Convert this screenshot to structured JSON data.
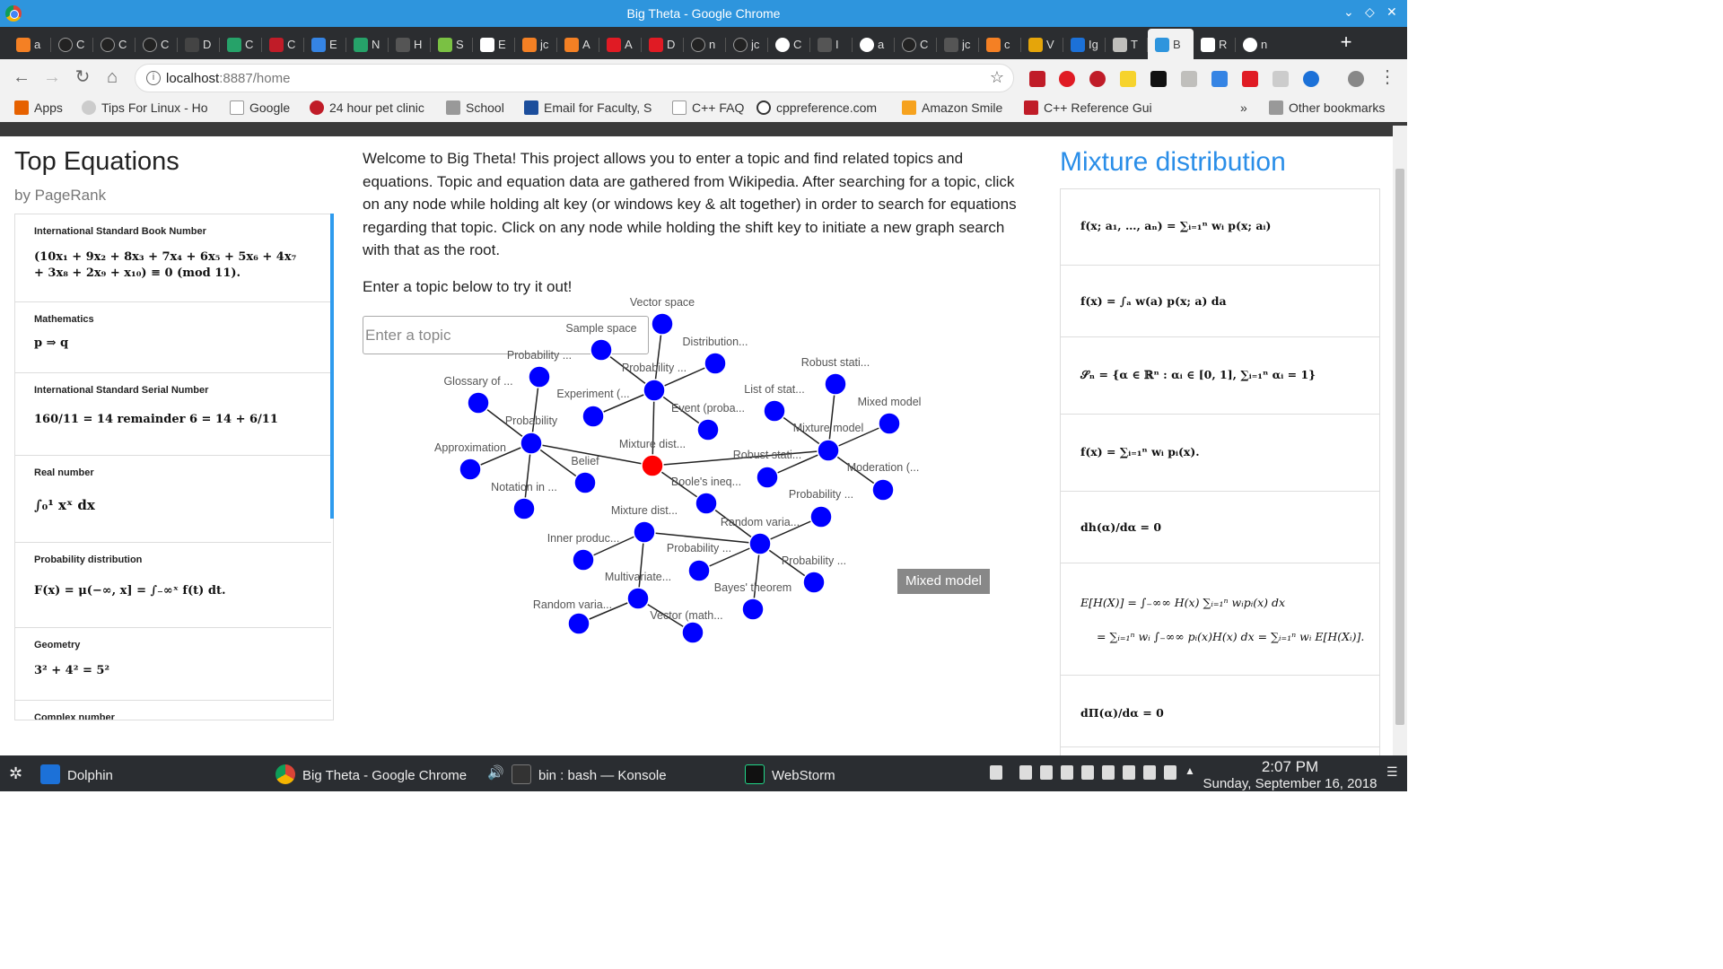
{
  "window": {
    "title": "Big Theta - Google Chrome"
  },
  "tabs": [
    "a",
    "C",
    "C",
    "C",
    "D",
    "C",
    "C",
    "E",
    "N",
    "H",
    "S",
    "E",
    "jc",
    "A",
    "A",
    "D",
    "n",
    "jc",
    "C",
    "I",
    "a",
    "C",
    "jc",
    "c",
    "V",
    "Iɡ",
    "T",
    "B",
    "R",
    "n"
  ],
  "address": {
    "host": "localhost",
    "rest": ":8887/home"
  },
  "bookmarks": [
    "Apps",
    "Tips For Linux - Ho",
    "Google",
    "24 hour pet clinic",
    "School",
    "Email for Faculty, S",
    "C++ FAQ",
    "cppreference.com",
    "Amazon Smile",
    "C++ Reference Gui",
    "»",
    "Other bookmarks"
  ],
  "left": {
    "title": "Top Equations",
    "subtitle": "by PageRank",
    "items": [
      {
        "name": "International Standard Book Number",
        "eq1": "(10x₁ + 9x₂ + 8x₃ + 7x₄ + 6x₅ + 5x₆ + 4x₇",
        "eq2": "+ 3x₈ + 2x₉ + x₁₀) ≡ 0   (mod 11)."
      },
      {
        "name": "Mathematics",
        "eq1": "p ⇒ q"
      },
      {
        "name": "International Standard Serial Number",
        "eq1": "160/11 = 14 remainder 6 = 14 + 6/11"
      },
      {
        "name": "Real number",
        "eq1": "∫₀¹ xˣ dx"
      },
      {
        "name": "Probability distribution",
        "eq1": "F(x) = μ(−∞, x] = ∫₋∞ˣ f(t) dt."
      },
      {
        "name": "Geometry",
        "eq1": "3² + 4² = 5²"
      },
      {
        "name": "Complex number",
        "eq1": ""
      }
    ]
  },
  "main": {
    "intro": "Welcome to Big Theta! This project allows you to enter a topic and find related topics and equations. Topic and equation data are gathered from Wikipedia. After searching for a topic, click on any node while holding alt key (or windows key & alt together) in order to search for equations regarding that topic. Click on any node while holding the shift key to initiate a new graph search with that as the root.",
    "prompt": "Enter a topic below to try it out!",
    "search_placeholder": "Enter a topic",
    "tooltip": "Mixed model",
    "root_color": "#ff0000",
    "node_color": "#0000ff",
    "graph_labels": [
      "Vector space",
      "Sample space",
      "Distribution...",
      "Probability ...",
      "Probability ...",
      "Glossary of ...",
      "Experiment (...",
      "Event (proba...",
      "List of stat...",
      "Robust stati...",
      "Mixed model",
      "Probability",
      "Mixture model",
      "Approximation",
      "Mixture dist...",
      "Belief",
      "Robust stati...",
      "Moderation (...",
      "Notation in ...",
      "Boole's ineq...",
      "Mixture dist...",
      "Probability ...",
      "Random varia...",
      "Inner produc...",
      "Probability ...",
      "Probability ...",
      "Multivariate...",
      "Bayes' theorem",
      "Random varia...",
      "Vector (math..."
    ]
  },
  "right": {
    "title": "Mixture distribution",
    "items": [
      "f(x; a₁, …, aₙ) = ∑ᵢ₌₁ⁿ wᵢ p(x; aᵢ)",
      "f(x) = ∫ₐ w(a) p(x; a) da",
      "𝒮ₙ = {α ∈ ℝⁿ : αᵢ ∈ [0, 1], ∑ᵢ₌₁ⁿ αᵢ = 1}",
      "f(x) = ∑ᵢ₌₁ⁿ wᵢ pᵢ(x).",
      "dh(α)/dα = 0",
      "E[H(X)] = ∫₋∞∞ H(x) ∑ᵢ₌₁ⁿ wᵢpᵢ(x) dx",
      "= ∑ᵢ₌₁ⁿ wᵢ ∫₋∞∞ pᵢ(x)H(x) dx = ∑ᵢ₌₁ⁿ wᵢ E[H(Xᵢ)].",
      "dΠ(α)/dα = 0"
    ]
  },
  "taskbar": {
    "items": [
      "Dolphin",
      "Big Theta - Google Chrome",
      "bin : bash — Konsole",
      "WebStorm"
    ],
    "time": "2:07 PM",
    "date": "Sunday, September 16, 2018"
  }
}
